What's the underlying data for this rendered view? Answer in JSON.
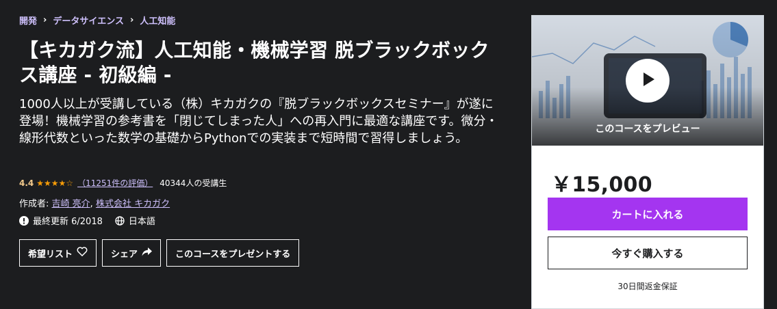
{
  "breadcrumb": {
    "items": [
      "開発",
      "データサイエンス",
      "人工知能"
    ]
  },
  "course": {
    "title": "【キカガク流】人工知能・機械学習 脱ブラックボックス講座 - 初級編 -",
    "subtitle": "1000人以上が受講している（株）キカガクの『脱ブラックボックスセミナー』が遂に登場！機械学習の参考書を「閉じてしまった人」への再入門に最適な講座です。微分・線形代数といった数学の基礎からPythonでの実装まで短時間で習得しましょう。",
    "rating": "4.4",
    "rating_value": 4.4,
    "rating_count": "（11251件の評価）",
    "students": "40344人の受講生",
    "author_prefix": "作成者:",
    "authors": [
      "吉崎 亮介",
      "株式会社 キカガク"
    ],
    "author_separator": ",",
    "last_updated": "最終更新 6/2018",
    "language": "日本語"
  },
  "actions": {
    "wishlist": "希望リスト",
    "share": "シェア",
    "gift": "このコースをプレゼントする"
  },
  "card": {
    "preview_label": "このコースをプレビュー",
    "price": "￥15,000",
    "add_to_cart": "カートに入れる",
    "buy_now": "今すぐ購入する",
    "guarantee": "30日間返金保証"
  },
  "colors": {
    "background": "#1c1d1f",
    "accent": "#a435f0",
    "link": "#cec0fc",
    "rating": "#f3ca8c",
    "star": "#f69c08"
  },
  "icons": {
    "breadcrumb_separator": "chevron-right-icon",
    "stars": "star-icon",
    "last_updated": "alert-icon",
    "language": "globe-icon",
    "wishlist": "heart-icon",
    "share": "share-arrow-icon",
    "preview": "play-icon"
  }
}
